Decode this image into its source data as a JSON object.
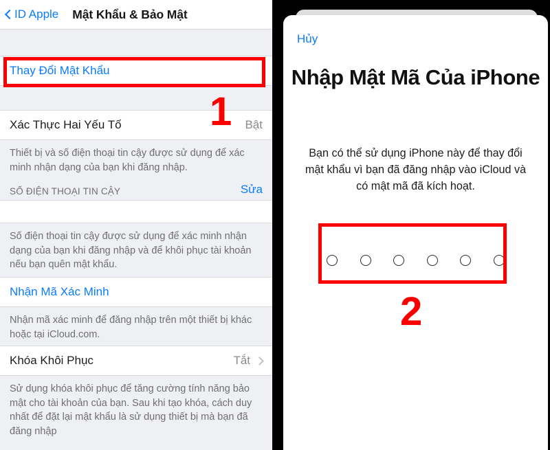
{
  "left_panel": {
    "nav": {
      "back_icon": "chevron-left-icon",
      "back_label": "ID Apple",
      "title": "Mật Khẩu & Bảo Mật"
    },
    "rows": {
      "change_password": "Thay Đổi Mật Khẩu",
      "two_factor_title": "Xác Thực Hai Yếu Tố",
      "two_factor_value": "Bật",
      "two_factor_footnote": "Thiết bị và số điện thoại tin cậy được sử dụng để xác minh nhận dạng của bạn khi đăng nhập.",
      "trusted_phone_header": "SỐ ĐIỆN THOẠI TIN CẬY",
      "trusted_phone_edit": "Sửa",
      "trusted_phone_footnote": "Số điện thoại tin cậy được sử dụng để xác minh nhận dạng của bạn khi đăng nhập và để khôi phục tài khoản nếu bạn quên mật khẩu.",
      "get_code_title": "Nhận Mã Xác Minh",
      "get_code_footnote": "Nhận mã xác minh để đăng nhập trên một thiết bị khác hoặc tại iCloud.com.",
      "recovery_key_title": "Khóa Khôi Phục",
      "recovery_key_value": "Tắt",
      "recovery_key_chevron": "chevron-right-icon",
      "recovery_key_footnote": "Sử dụng khóa khôi phục để tăng cường tính năng bảo mật cho tài khoản của bạn. Sau khi tạo khóa, cách duy nhất để đặt lại mật khẩu là sử dụng thiết bị mà bạn đã đăng nhập"
    }
  },
  "right_panel": {
    "cancel_label": "Hủy",
    "title": "Nhập Mật Mã Của iPhone",
    "description": "Bạn có thể sử dụng iPhone này để thay đổi mật khẩu vì bạn đã đăng nhập vào iCloud và có mật mã đã kích hoạt.",
    "passcode_dots": 6
  },
  "annotations": {
    "step_one": "1",
    "step_two": "2",
    "highlight_color": "#fc0000"
  },
  "colors": {
    "accent_blue": "#0a7cff",
    "group_background": "#eff0f4",
    "cell_background": "#ffffff",
    "secondary_text": "#8a8a8e"
  }
}
